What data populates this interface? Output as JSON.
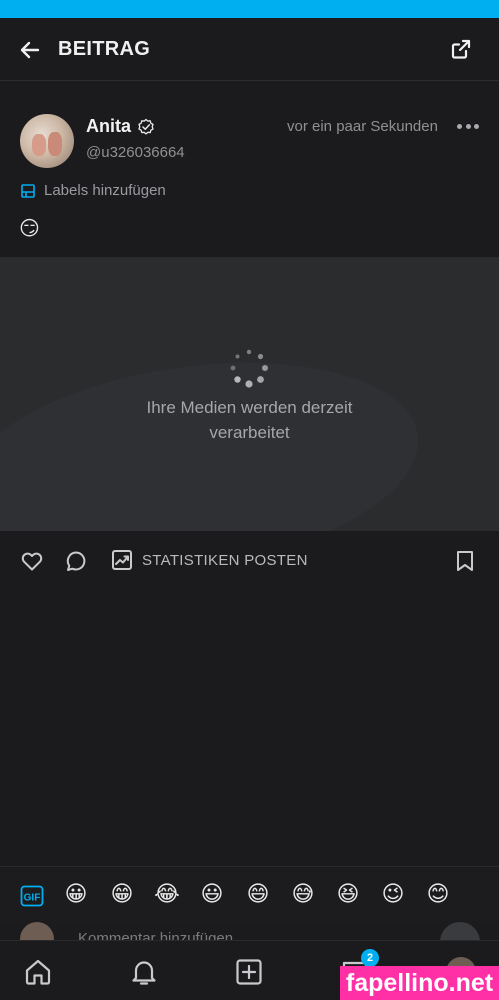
{
  "colors": {
    "accent": "#00aff0",
    "background": "#1b1b1d",
    "watermark": "#ff2fa5"
  },
  "header": {
    "title": "BEITRAG",
    "back_icon": "arrow-left-icon",
    "share_icon": "share-icon"
  },
  "post": {
    "author_name": "Anita",
    "author_handle": "@u326036664",
    "verified_icon": "verified-icon",
    "timestamp": "vor ein paar Sekunden",
    "more_icon": "more-horizontal-icon",
    "labels_action": "Labels hinzufügen",
    "text": "😏",
    "media_message_line1": "Ihre Medien werden derzeit",
    "media_message_line2": "verarbeitet"
  },
  "actions": {
    "like_icon": "heart-icon",
    "comment_icon": "comment-icon",
    "stats_icon": "stats-icon",
    "stats_label": "STATISTIKEN POSTEN",
    "bookmark_icon": "bookmark-icon"
  },
  "emoji_bar": {
    "gif_label": "GIF",
    "emojis": [
      "😀",
      "😁",
      "😂",
      "😃",
      "😄",
      "😅",
      "😆",
      "😉",
      "😊"
    ]
  },
  "comment": {
    "placeholder": "Kommentar hinzufügen"
  },
  "bottom_nav": {
    "items": [
      "home-icon",
      "bell-icon",
      "add-icon",
      "messages-icon",
      "profile-avatar"
    ],
    "messages_badge": "2"
  },
  "watermark": "fapellino.net"
}
